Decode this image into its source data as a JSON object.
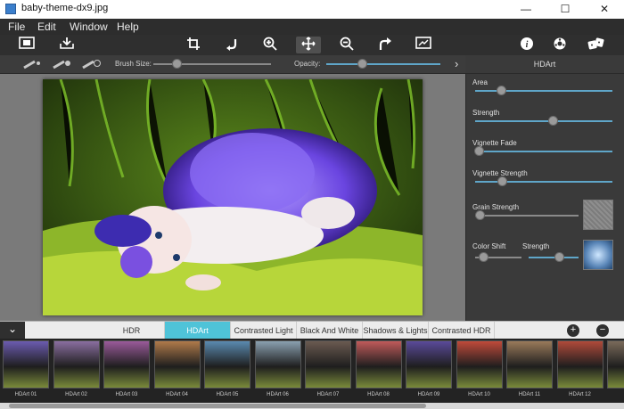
{
  "window": {
    "title": "baby-theme-dx9.jpg",
    "minimize": "—",
    "maximize": "☐",
    "close": "✕"
  },
  "menu": [
    "File",
    "Edit",
    "Window",
    "Help"
  ],
  "toolbar": {
    "icons": [
      "frame-icon",
      "save-icon",
      "crop-icon",
      "rotate-icon",
      "zoom-in-icon",
      "move-icon",
      "zoom-out-icon",
      "redo-icon",
      "fit-icon",
      "info-icon",
      "settings-icon",
      "dice-icon"
    ],
    "active": "move-icon"
  },
  "subbar": {
    "brush_size_label": "Brush Size:",
    "opacity_label": "Opacity:",
    "brush_size_value": 0.2,
    "opacity_value": 0.32,
    "arrow": "›"
  },
  "panel": {
    "title": "HDArt",
    "sliders": [
      {
        "label": "Area",
        "value": 0.19
      },
      {
        "label": "Strength",
        "value": 0.57
      },
      {
        "label": "Vignette Fade",
        "value": 0.03
      },
      {
        "label": "Vignette Strength",
        "value": 0.2
      }
    ],
    "grain_label": "Grain Strength",
    "grain_value": 0.05,
    "color_shift_label": "Color Shift",
    "color_shift_value": 0.18,
    "strength2_label": "Strength",
    "strength2_value": 0.62
  },
  "tabs": [
    {
      "label": "HDR",
      "active": false
    },
    {
      "label": "HDArt",
      "active": true
    },
    {
      "label": "Contrasted Light",
      "active": false
    },
    {
      "label": "Black And White",
      "active": false
    },
    {
      "label": "Shadows & Lights",
      "active": false
    },
    {
      "label": "Contrasted HDR",
      "active": false
    }
  ],
  "tab_controls": {
    "collapse": "⌄",
    "add": "+",
    "remove": "−"
  },
  "thumbnails": [
    {
      "label": "HDArt 01",
      "color": "#6b5bb0"
    },
    {
      "label": "HDArt 02",
      "color": "#8a6ea0"
    },
    {
      "label": "HDArt 03",
      "color": "#9a5a9a"
    },
    {
      "label": "HDArt 04",
      "color": "#b07a4a"
    },
    {
      "label": "HDArt 05",
      "color": "#5a8ab0"
    },
    {
      "label": "HDArt 06",
      "color": "#8aa0b0"
    },
    {
      "label": "HDArt 07",
      "color": "#6a5a50"
    },
    {
      "label": "HDArt 08",
      "color": "#c05a5a"
    },
    {
      "label": "HDArt 09",
      "color": "#5a4a9a"
    },
    {
      "label": "HDArt 10",
      "color": "#c04a3a"
    },
    {
      "label": "HDArt 11",
      "color": "#9a7a5a"
    },
    {
      "label": "HDArt 12",
      "color": "#b04a3a"
    },
    {
      "label": "",
      "color": "#7a6a5a"
    }
  ]
}
